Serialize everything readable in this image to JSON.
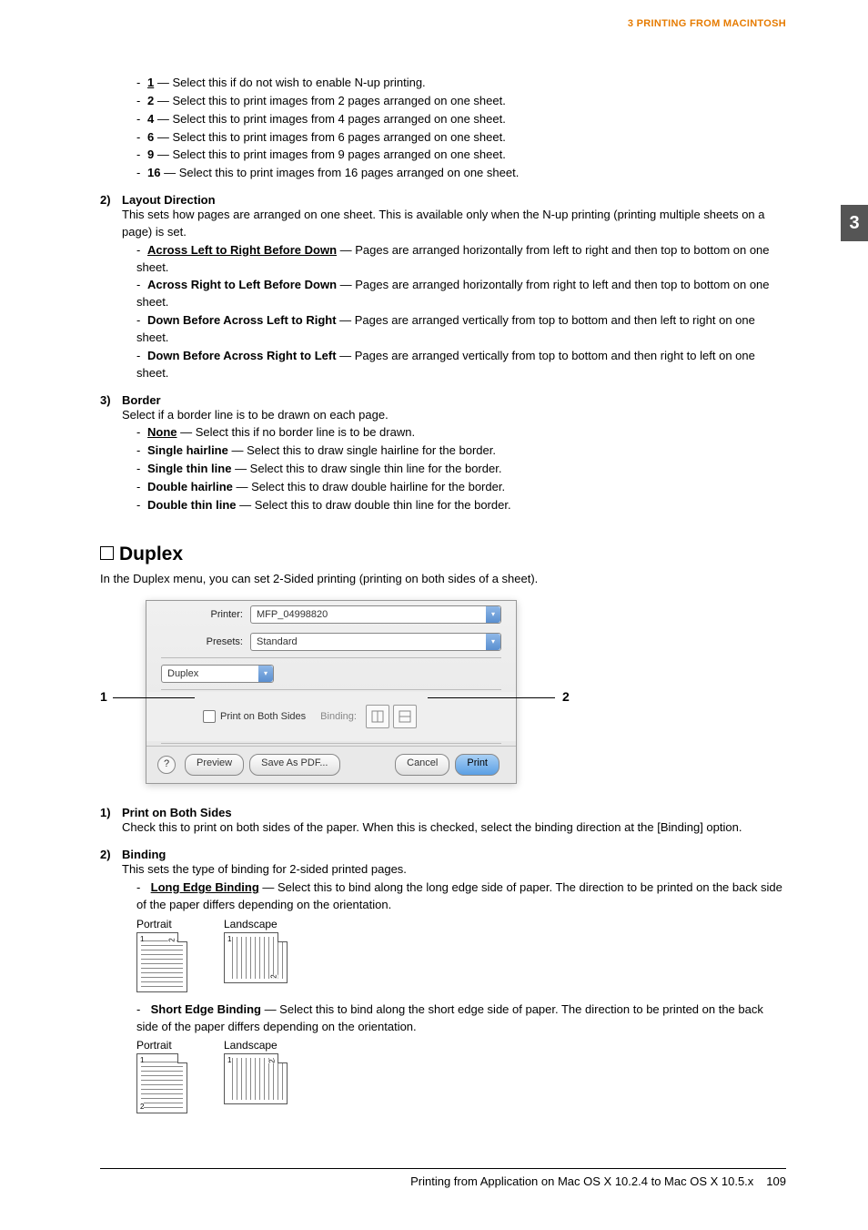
{
  "header": {
    "breadcrumb": "3 PRINTING FROM MACINTOSH"
  },
  "side_tab": "3",
  "nup": {
    "items": [
      {
        "opt": "1",
        "underline": true,
        "desc": " — Select this if do not wish to enable N-up printing."
      },
      {
        "opt": "2",
        "underline": false,
        "desc": " — Select this to print images from 2 pages arranged on one sheet."
      },
      {
        "opt": "4",
        "underline": false,
        "desc": " — Select this to print images from 4 pages arranged on one sheet."
      },
      {
        "opt": "6",
        "underline": false,
        "desc": " — Select this to print images from 6 pages arranged on one sheet."
      },
      {
        "opt": "9",
        "underline": false,
        "desc": " — Select this to print images from 9 pages arranged on one sheet."
      },
      {
        "opt": "16",
        "underline": false,
        "desc": " — Select this to print images from 16 pages arranged on one sheet."
      }
    ]
  },
  "layout_direction": {
    "num": "2)",
    "title": "Layout Direction",
    "desc": "This sets how pages are arranged on one sheet.  This is available only when the N-up printing (printing multiple sheets on a page) is set.",
    "items": [
      {
        "opt": "Across Left to Right Before Down",
        "underline": true,
        "desc": " — Pages are arranged horizontally from left to right and then top to bottom on one sheet."
      },
      {
        "opt": "Across Right to Left Before Down",
        "underline": false,
        "desc": " — Pages are arranged horizontally from right to left and then top to bottom on one sheet."
      },
      {
        "opt": "Down Before Across Left to Right",
        "underline": false,
        "desc": " — Pages are arranged vertically from top to bottom and then left to right on one sheet."
      },
      {
        "opt": "Down Before Across Right to Left",
        "underline": false,
        "desc": " — Pages are arranged vertically from top to bottom and then right to left on one sheet."
      }
    ]
  },
  "border": {
    "num": "3)",
    "title": "Border",
    "desc": "Select if a border line is to be drawn on each page.",
    "items": [
      {
        "opt": "None",
        "underline": true,
        "desc": " — Select this if no border line is to be drawn."
      },
      {
        "opt": "Single hairline",
        "underline": false,
        "desc": " — Select this to draw single hairline for the border."
      },
      {
        "opt": "Single thin line",
        "underline": false,
        "desc": " — Select this to draw single thin line for the border."
      },
      {
        "opt": "Double hairline",
        "underline": false,
        "desc": " — Select this to draw double hairline for the border."
      },
      {
        "opt": "Double thin line",
        "underline": false,
        "desc": " — Select this to draw double thin line for the border."
      }
    ]
  },
  "duplex": {
    "heading": "Duplex",
    "intro": "In the Duplex menu, you can set 2-Sided printing (printing on both sides of a sheet).",
    "callout_left": "1",
    "callout_right": "2",
    "dialog": {
      "printer_label": "Printer:",
      "printer_value": "MFP_04998820",
      "presets_label": "Presets:",
      "presets_value": "Standard",
      "pane_value": "Duplex",
      "checkbox_label": "Print on Both Sides",
      "binding_label": "Binding:",
      "help": "?",
      "btn_preview": "Preview",
      "btn_saveas": "Save As PDF...",
      "btn_cancel": "Cancel",
      "btn_print": "Print"
    },
    "print_both": {
      "num": "1)",
      "title": "Print on Both Sides",
      "desc": "Check this to print on both sides of the paper.  When this is checked, select the binding direction at the [Binding] option."
    },
    "binding": {
      "num": "2)",
      "title": "Binding",
      "desc": "This sets the type of binding for 2-sided printed pages.",
      "long": {
        "opt": "Long Edge Binding",
        "desc": " — Select this to bind along the long edge side of paper. The direction to be printed on the back side of the paper differs depending on the orientation."
      },
      "short": {
        "opt": "Short Edge Binding",
        "desc": " — Select this to bind along the short edge side of paper. The direction to be printed on the back side of the paper differs depending on the orientation."
      },
      "orient_portrait": "Portrait",
      "orient_landscape": "Landscape"
    }
  },
  "footer": {
    "text": "Printing from Application on Mac OS X 10.2.4 to Mac OS X 10.5.x",
    "page": "109"
  }
}
